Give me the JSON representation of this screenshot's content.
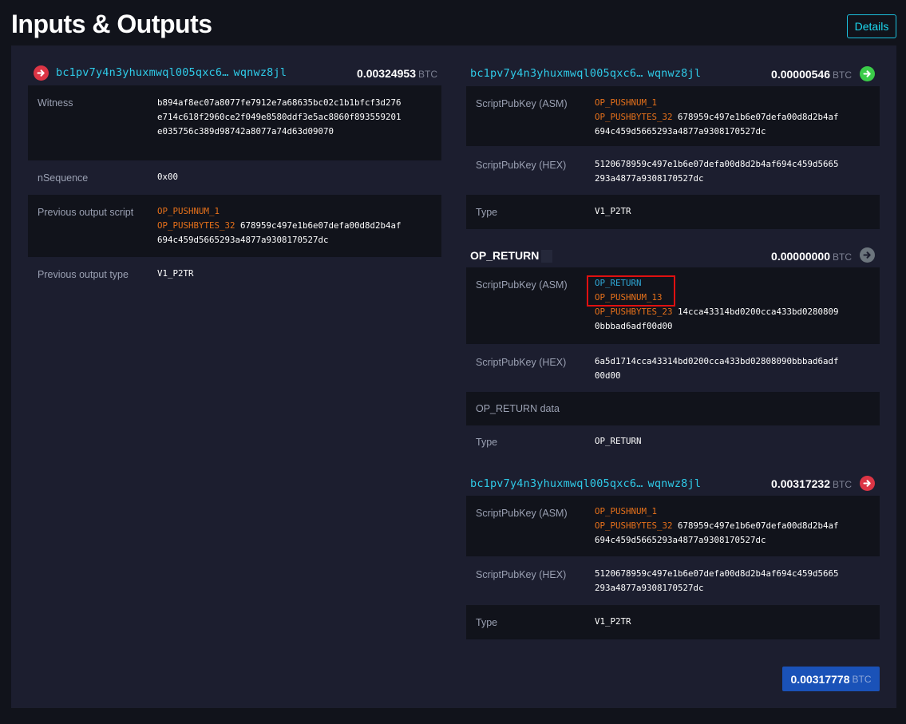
{
  "page": {
    "title": "Inputs & Outputs",
    "details_label": "Details"
  },
  "inputs": [
    {
      "address_start": "bc1pv7y4n3yhuxmwql005qxc6…",
      "address_end": "wqnwz8jl",
      "amount": "0.00324953",
      "unit": "BTC",
      "witness_label": "Witness",
      "witness_lines": [
        "b894af8ec07a8077fe7912e7a68635bc02c1b1bfcf3d276",
        "e714c618f2960ce2f049e8580ddf3e5ac8860f893559201",
        "e035756c389d98742a8077a74d63d09070"
      ],
      "nsequence_label": "nSequence",
      "nsequence": "0x00",
      "prev_script_label": "Previous output script",
      "prev_script_op1": "OP_PUSHNUM_1",
      "prev_script_op2": "OP_PUSHBYTES_32",
      "prev_script_data1": "678959c497e1b6e07defa00d8d2b4af",
      "prev_script_data2": "694c459d5665293a4877a9308170527dc",
      "prev_type_label": "Previous output type",
      "prev_type": "V1_P2TR"
    }
  ],
  "outputs": [
    {
      "address_start": "bc1pv7y4n3yhuxmwql005qxc6…",
      "address_end": "wqnwz8jl",
      "amount": "0.00000546",
      "unit": "BTC",
      "asm_label": "ScriptPubKey (ASM)",
      "asm_op1": "OP_PUSHNUM_1",
      "asm_op2": "OP_PUSHBYTES_32",
      "asm_data1": "678959c497e1b6e07defa00d8d2b4af",
      "asm_data2": "694c459d5665293a4877a9308170527dc",
      "hex_label": "ScriptPubKey (HEX)",
      "hex_line1": "5120678959c497e1b6e07defa00d8d2b4af694c459d5665",
      "hex_line2": "293a4877a9308170527dc",
      "type_label": "Type",
      "type": "V1_P2TR"
    },
    {
      "title": "OP_RETURN",
      "amount": "0.00000000",
      "unit": "BTC",
      "asm_label": "ScriptPubKey (ASM)",
      "asm_op1": "OP_RETURN",
      "asm_op2": "OP_PUSHNUM_13",
      "asm_op3": "OP_PUSHBYTES_23",
      "asm_data1": "14cca43314bd0200cca433bd0280809",
      "asm_data2": "0bbbad6adf00d00",
      "hex_label": "ScriptPubKey (HEX)",
      "hex_line1": "6a5d1714cca43314bd0200cca433bd02808090bbbad6adf",
      "hex_line2": "00d00",
      "data_label": "OP_RETURN data",
      "type_label": "Type",
      "type": "OP_RETURN"
    },
    {
      "address_start": "bc1pv7y4n3yhuxmwql005qxc6…",
      "address_end": "wqnwz8jl",
      "amount": "0.00317232",
      "unit": "BTC",
      "asm_label": "ScriptPubKey (ASM)",
      "asm_op1": "OP_PUSHNUM_1",
      "asm_op2": "OP_PUSHBYTES_32",
      "asm_data1": "678959c497e1b6e07defa00d8d2b4af",
      "asm_data2": "694c459d5665293a4877a9308170527dc",
      "hex_label": "ScriptPubKey (HEX)",
      "hex_line1": "5120678959c497e1b6e07defa00d8d2b4af694c459d5665",
      "hex_line2": "293a4877a9308170527dc",
      "type_label": "Type",
      "type": "V1_P2TR"
    }
  ],
  "total": {
    "amount": "0.00317778",
    "unit": "BTC"
  },
  "colors": {
    "accent": "#2fcbe8",
    "op_code": "#e7711b",
    "arrow_in": "#dc3545",
    "arrow_out": "#3bcc49",
    "total_bg": "#1a52b8"
  }
}
